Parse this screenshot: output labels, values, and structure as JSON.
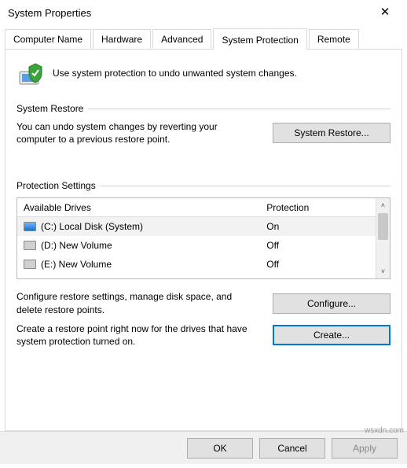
{
  "window": {
    "title": "System Properties"
  },
  "tabs": [
    {
      "label": "Computer Name"
    },
    {
      "label": "Hardware"
    },
    {
      "label": "Advanced"
    },
    {
      "label": "System Protection",
      "active": true
    },
    {
      "label": "Remote"
    }
  ],
  "intro": {
    "text": "Use system protection to undo unwanted system changes."
  },
  "restore": {
    "group_label": "System Restore",
    "text": "You can undo system changes by reverting your computer to a previous restore point.",
    "button": "System Restore..."
  },
  "settings": {
    "group_label": "Protection Settings",
    "col_drive": "Available Drives",
    "col_prot": "Protection",
    "drives": [
      {
        "icon": "sys",
        "name": "(C:) Local Disk (System)",
        "protection": "On",
        "selected": true
      },
      {
        "icon": "hdd",
        "name": "(D:) New Volume",
        "protection": "Off",
        "selected": false
      },
      {
        "icon": "hdd",
        "name": "(E:) New Volume",
        "protection": "Off",
        "selected": false
      }
    ],
    "configure_text": "Configure restore settings, manage disk space, and delete restore points.",
    "configure_button": "Configure...",
    "create_text": "Create a restore point right now for the drives that have system protection turned on.",
    "create_button": "Create..."
  },
  "footer": {
    "ok": "OK",
    "cancel": "Cancel",
    "apply": "Apply"
  },
  "watermark": "wsxdn.com"
}
